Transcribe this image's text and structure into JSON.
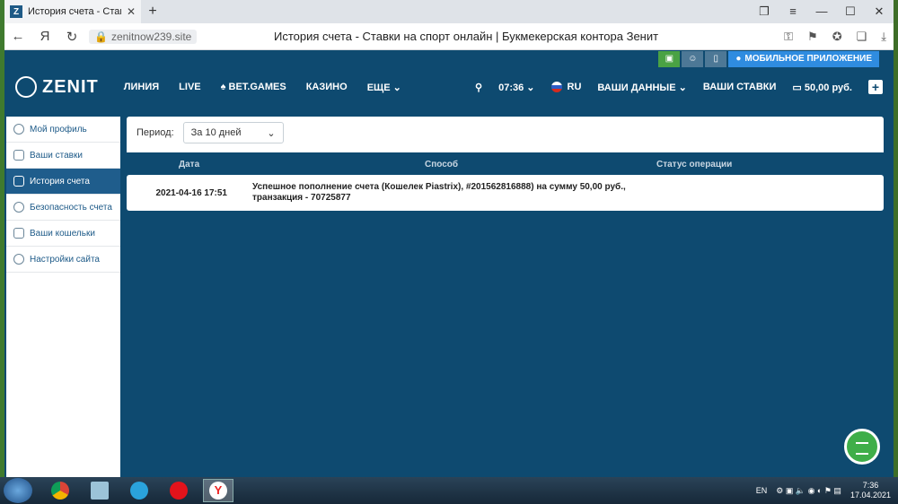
{
  "browser": {
    "tab_title": "История счета - Ставки н",
    "url": "zenitnow239.site",
    "page_title": "История счета - Ставки на спорт онлайн | Букмекерская контора Зенит"
  },
  "site": {
    "mobile_app": "МОБИЛЬНОЕ ПРИЛОЖЕНИЕ",
    "logo": "ZENIT",
    "nav": [
      "ЛИНИЯ",
      "LIVE",
      "BET.GAMES",
      "КАЗИНО",
      "ЕЩЕ"
    ],
    "time": "07:36",
    "lang": "RU",
    "your_data": "ВАШИ ДАННЫЕ",
    "your_bets": "ВАШИ СТАВКИ",
    "balance": "50,00 руб."
  },
  "sidebar": {
    "items": [
      {
        "label": "Мой профиль"
      },
      {
        "label": "Ваши ставки"
      },
      {
        "label": "История счета"
      },
      {
        "label": "Безопасность счета"
      },
      {
        "label": "Ваши кошельки"
      },
      {
        "label": "Настройки сайта"
      }
    ]
  },
  "history": {
    "period_label": "Период:",
    "period_value": "За 10 дней",
    "columns": [
      "Дата",
      "Способ",
      "Статус операции"
    ],
    "rows": [
      {
        "date": "2021-04-16 17:51",
        "method": "Успешное пополнение счета (Кошелек Piastrix), #201562816888) на сумму 50,00 руб., транзакция - 70725877",
        "status": ""
      }
    ]
  },
  "taskbar": {
    "lang": "EN",
    "time": "7:36",
    "date": "17.04.2021"
  }
}
